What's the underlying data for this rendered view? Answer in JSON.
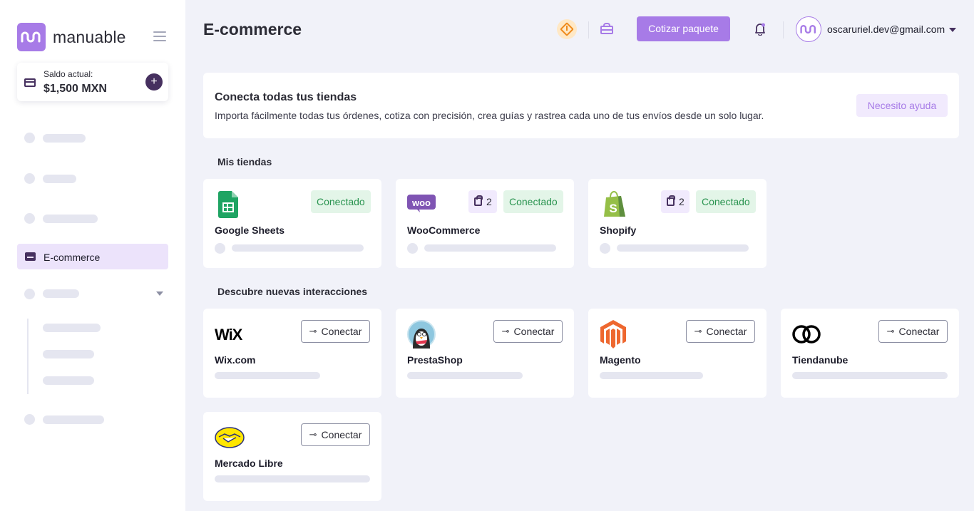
{
  "brand": {
    "name": "manuable",
    "accent": "#a77be7",
    "dark": "#46305f"
  },
  "balance": {
    "label": "Saldo actual:",
    "value": "$1,500 MXN",
    "add_label": "+"
  },
  "sidebar": {
    "active_item": "E-commerce"
  },
  "header": {
    "title": "E-commerce",
    "quote_button": "Cotizar paquete",
    "user_email": "oscaruriel.dev@gmail.com"
  },
  "banner": {
    "title": "Conecta todas tus tiendas",
    "subtitle": "Importa fácilmente todas tus órdenes, cotiza con precisión, crea guías y rastrea cada uno de tus envíos desde un solo lugar.",
    "help_button": "Necesito ayuda"
  },
  "my_stores": {
    "label": "Mis tiendas",
    "items": [
      {
        "name": "Google Sheets",
        "status": "Conectado",
        "orders": null,
        "icon": "google-sheets-icon"
      },
      {
        "name": "WooCommerce",
        "status": "Conectado",
        "orders": "2",
        "icon": "woocommerce-icon"
      },
      {
        "name": "Shopify",
        "status": "Conectado",
        "orders": "2",
        "icon": "shopify-icon"
      }
    ]
  },
  "discover": {
    "label": "Descubre nuevas interacciones",
    "connect_label": "Conectar",
    "items": [
      {
        "name": "Wix.com",
        "logo_text": "WiX",
        "icon": "wix-icon"
      },
      {
        "name": "PrestaShop",
        "icon": "prestashop-icon"
      },
      {
        "name": "Magento",
        "icon": "magento-icon"
      },
      {
        "name": "Tiendanube",
        "icon": "tiendanube-icon"
      },
      {
        "name": "Mercado Libre",
        "icon": "mercado-libre-icon"
      }
    ]
  }
}
